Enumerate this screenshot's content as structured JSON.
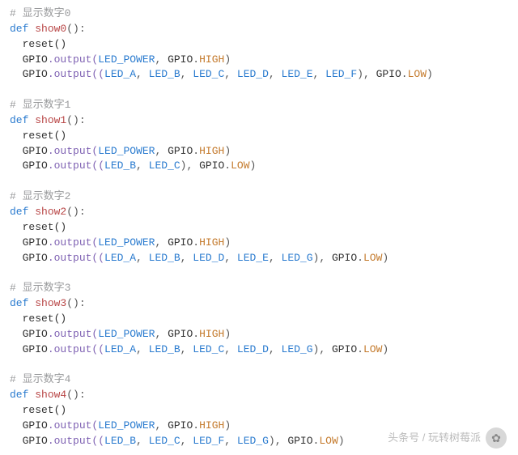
{
  "functions": [
    {
      "comment": "# 显示数字0",
      "def_kw": "def",
      "name": "show0",
      "sig": "():",
      "reset": "reset()",
      "power_prefix": "GPIO",
      "power_method": ".output(",
      "power_arg": "LED_POWER",
      "power_comma": ", ",
      "power_gpio": "GPIO",
      "power_dot": ".",
      "power_state": "HIGH",
      "power_close": ")",
      "out_prefix": "GPIO",
      "out_method": ".output((",
      "pins": [
        "LED_A",
        "LED_B",
        "LED_C",
        "LED_D",
        "LED_E",
        "LED_F"
      ],
      "out_mid": "), ",
      "out_gpio": "GPIO",
      "out_dot": ".",
      "out_state": "LOW",
      "out_close": ")"
    },
    {
      "comment": "# 显示数字1",
      "def_kw": "def",
      "name": "show1",
      "sig": "():",
      "reset": "reset()",
      "power_prefix": "GPIO",
      "power_method": ".output(",
      "power_arg": "LED_POWER",
      "power_comma": ", ",
      "power_gpio": "GPIO",
      "power_dot": ".",
      "power_state": "HIGH",
      "power_close": ")",
      "out_prefix": "GPIO",
      "out_method": ".output((",
      "pins": [
        "LED_B",
        "LED_C"
      ],
      "out_mid": "), ",
      "out_gpio": "GPIO",
      "out_dot": ".",
      "out_state": "LOW",
      "out_close": ")"
    },
    {
      "comment": "# 显示数字2",
      "def_kw": "def",
      "name": "show2",
      "sig": "():",
      "reset": "reset()",
      "power_prefix": "GPIO",
      "power_method": ".output(",
      "power_arg": "LED_POWER",
      "power_comma": ", ",
      "power_gpio": "GPIO",
      "power_dot": ".",
      "power_state": "HIGH",
      "power_close": ")",
      "out_prefix": "GPIO",
      "out_method": ".output((",
      "pins": [
        "LED_A",
        "LED_B",
        "LED_D",
        "LED_E",
        "LED_G"
      ],
      "out_mid": "), ",
      "out_gpio": "GPIO",
      "out_dot": ".",
      "out_state": "LOW",
      "out_close": ")"
    },
    {
      "comment": "# 显示数字3",
      "def_kw": "def",
      "name": "show3",
      "sig": "():",
      "reset": "reset()",
      "power_prefix": "GPIO",
      "power_method": ".output(",
      "power_arg": "LED_POWER",
      "power_comma": ", ",
      "power_gpio": "GPIO",
      "power_dot": ".",
      "power_state": "HIGH",
      "power_close": ")",
      "out_prefix": "GPIO",
      "out_method": ".output((",
      "pins": [
        "LED_A",
        "LED_B",
        "LED_C",
        "LED_D",
        "LED_G"
      ],
      "out_mid": "), ",
      "out_gpio": "GPIO",
      "out_dot": ".",
      "out_state": "LOW",
      "out_close": ")"
    },
    {
      "comment": "# 显示数字4",
      "def_kw": "def",
      "name": "show4",
      "sig": "():",
      "reset": "reset()",
      "power_prefix": "GPIO",
      "power_method": ".output(",
      "power_arg": "LED_POWER",
      "power_comma": ", ",
      "power_gpio": "GPIO",
      "power_dot": ".",
      "power_state": "HIGH",
      "power_close": ")",
      "out_prefix": "GPIO",
      "out_method": ".output((",
      "pins": [
        "LED_B",
        "LED_C",
        "LED_F",
        "LED_G"
      ],
      "out_mid": "), ",
      "out_gpio": "GPIO",
      "out_dot": ".",
      "out_state": "LOW",
      "out_close": ")"
    }
  ],
  "watermark": {
    "text": "头条号 / 玩转树莓派",
    "icon_label": "玩转树莓派"
  }
}
